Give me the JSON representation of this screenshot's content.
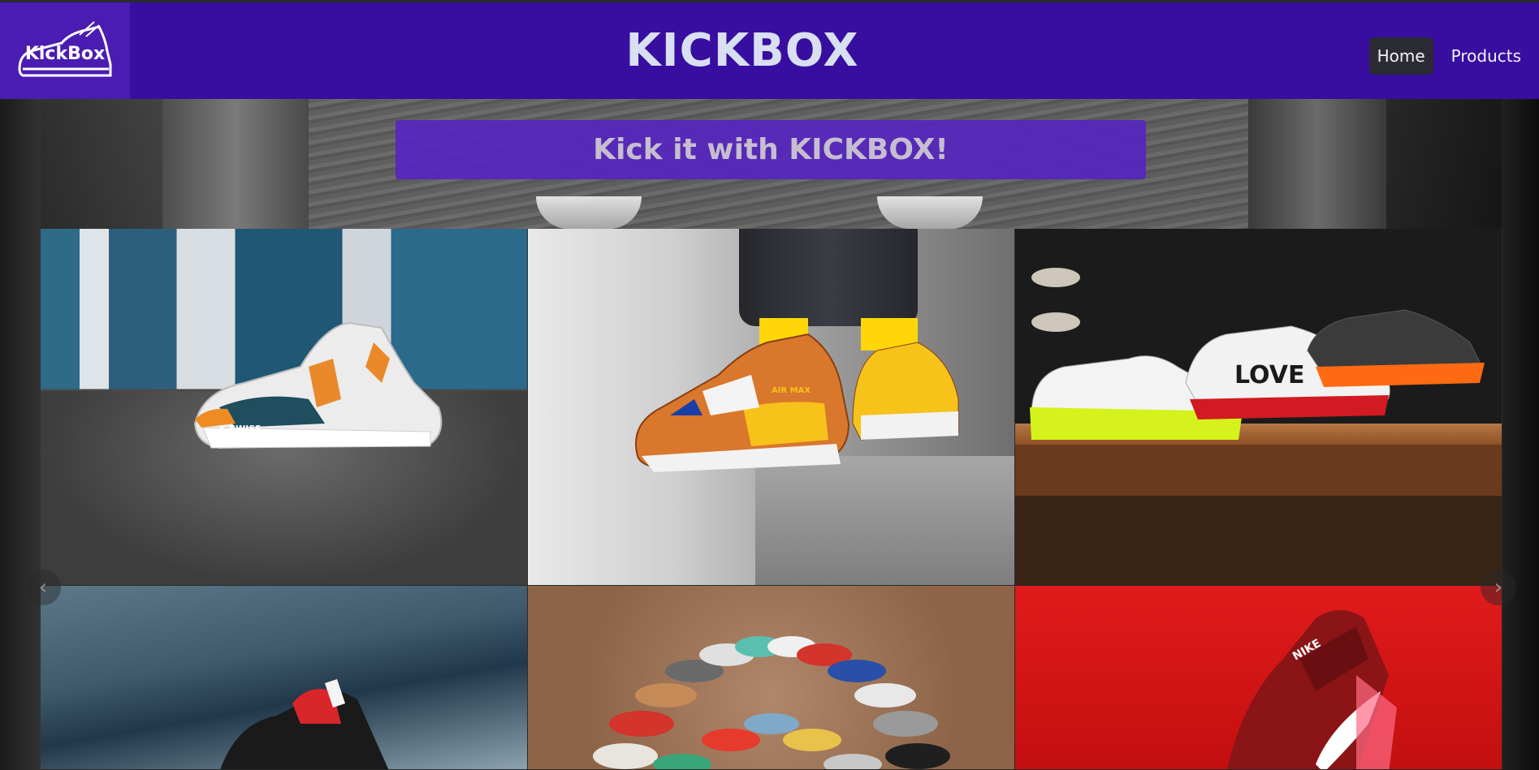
{
  "header": {
    "logo_text": "KickBox",
    "site_title": "KICKBOX",
    "nav": [
      {
        "label": "Home",
        "active": true
      },
      {
        "label": "Products",
        "active": false
      }
    ]
  },
  "hero": {
    "tagline": "Kick it with KICKBOX!"
  },
  "products": [
    {
      "name": "white-teal-k-swiss-sneaker",
      "shoe_text": "K-SWISS"
    },
    {
      "name": "orange-air-max-90-sneaker",
      "shoe_text": "AIR MAX"
    },
    {
      "name": "three-fashion-sneakers-on-shelf",
      "shoe_text": "LOVE"
    },
    {
      "name": "black-red-sneaker-on-track"
    },
    {
      "name": "air-max-collection-fan"
    },
    {
      "name": "red-knit-running-shoe",
      "shoe_text": "NIKE"
    }
  ],
  "carousel": {
    "prev_icon": "chevron-left-icon",
    "next_icon": "chevron-right-icon"
  },
  "colors": {
    "header_bg": "#380ea0",
    "logo_bg": "#4a1cb2",
    "tagline_bg": "#5626be",
    "title_text": "#d9dff2"
  }
}
